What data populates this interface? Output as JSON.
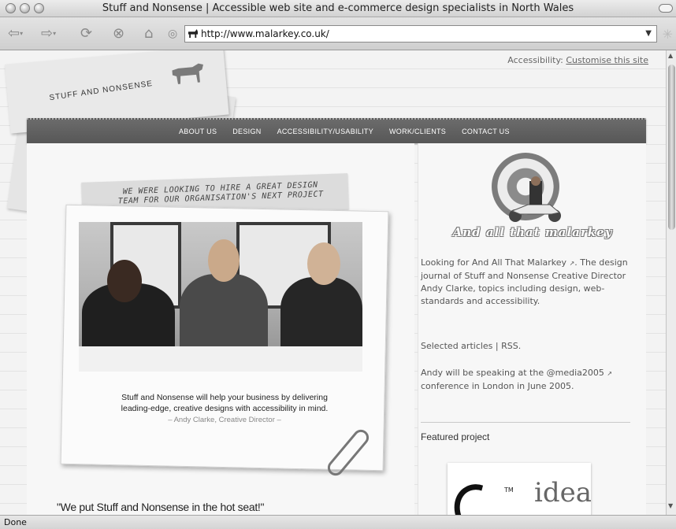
{
  "window": {
    "title": "Stuff and Nonsense | Accessible web site and e-commerce design specialists in North Wales"
  },
  "toolbar": {
    "back_icon": "arrow-left-icon",
    "forward_icon": "arrow-right-icon",
    "reload_icon": "reload-icon",
    "stop_icon": "stop-icon",
    "home_icon": "home-icon",
    "url": "http://www.malarkey.co.uk/"
  },
  "status": {
    "text": "Done"
  },
  "site": {
    "accessibility_label": "Accessibility:",
    "accessibility_link": "Customise this site",
    "logo_text": "STUFF AND NONSENSE",
    "nav": [
      "ABOUT US",
      "DESIGN",
      "ACCESSIBILITY/USABILITY",
      "WORK/CLIENTS",
      "CONTACT US"
    ],
    "banner_line1": "WE WERE LOOKING TO HIRE A GREAT DESIGN",
    "banner_line2": "TEAM FOR OUR ORGANISATION'S NEXT PROJECT",
    "quote_line1": "Stuff and Nonsense will help your business by delivering",
    "quote_line2": "leading-edge, creative designs with accessibility in mind.",
    "quote_cite": "– Andy Clarke, Creative Director –",
    "hotseat": "\"We put Stuff and Nonsense in the hot seat!\""
  },
  "sidebar": {
    "logo_text": "And all that malarkey",
    "para1_link": "Looking for And All That Malarkey",
    "para1_rest": "The design journal of Stuff and Nonsense Creative Director Andy Clarke, topics including design, web-standards and accessibility.",
    "selected_articles": "Selected articles",
    "separator": "|",
    "rss": "RSS.",
    "para3_start": "Andy will be speaking at the",
    "para3_link": "@media2005",
    "para3_end": "conference in London in June 2005.",
    "featured_title": "Featured project",
    "featured_word": "idea",
    "featured_tm": "TM"
  },
  "colors": {
    "nav_bg": "#5f5f5f",
    "page_bg": "#f3f3f3",
    "text": "#555555"
  }
}
